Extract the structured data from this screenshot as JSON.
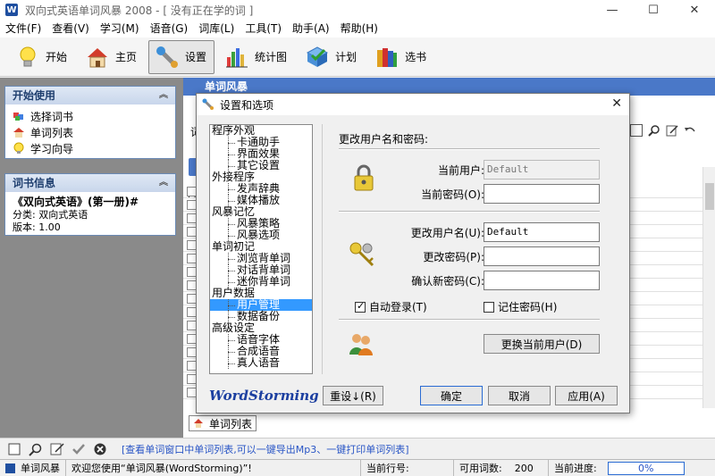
{
  "window": {
    "title": "双向式英语单词风暴 2008 - [ 没有正在学的词 ]",
    "icon_letter": "W",
    "controls": {
      "min": "—",
      "max": "☐",
      "close": "✕"
    }
  },
  "menu": [
    "文件(F)",
    "查看(V)",
    "学习(M)",
    "语音(G)",
    "词库(L)",
    "工具(T)",
    "助手(A)",
    "帮助(H)"
  ],
  "toolbar": [
    {
      "label": "开始",
      "icon": "lightbulb-icon"
    },
    {
      "label": "主页",
      "icon": "house-icon"
    },
    {
      "label": "设置",
      "icon": "wrench-icon",
      "active": true
    },
    {
      "label": "统计图",
      "icon": "bar-chart-icon"
    },
    {
      "label": "计划",
      "icon": "plan-icon"
    },
    {
      "label": "选书",
      "icon": "books-icon"
    }
  ],
  "left_panel": {
    "start_title": "开始使用",
    "start_items": [
      {
        "label": "选择词书",
        "icon": "cube-icon"
      },
      {
        "label": "单词列表",
        "icon": "house-icon"
      },
      {
        "label": "学习向导",
        "icon": "lightbulb-icon"
      }
    ],
    "book_title": "词书信息",
    "book_name": "《双向式英语》(第一册)#",
    "book_category": "分类: 双向式英语",
    "book_version": "版本: 1.00"
  },
  "main": {
    "header": "单词风暴",
    "row_prefix_1": "词",
    "row_prefix_2": "词",
    "tab_label": "单词列表"
  },
  "dialog": {
    "title": "设置和选项",
    "close": "✕",
    "tree": [
      {
        "label": "程序外观",
        "level": 0
      },
      {
        "label": "卡通助手",
        "level": 1
      },
      {
        "label": "界面效果",
        "level": 1
      },
      {
        "label": "其它设置",
        "level": 1
      },
      {
        "label": "外接程序",
        "level": 0
      },
      {
        "label": "发声辞典",
        "level": 1
      },
      {
        "label": "媒体播放",
        "level": 1
      },
      {
        "label": "风暴记忆",
        "level": 0
      },
      {
        "label": "风暴策略",
        "level": 1
      },
      {
        "label": "风暴选项",
        "level": 1
      },
      {
        "label": "单词初记",
        "level": 0
      },
      {
        "label": "浏览背单词",
        "level": 1
      },
      {
        "label": "对话背单词",
        "level": 1
      },
      {
        "label": "迷你背单词",
        "level": 1
      },
      {
        "label": "用户数据",
        "level": 0
      },
      {
        "label": "用户管理",
        "level": 1,
        "selected": true
      },
      {
        "label": "数据备份",
        "level": 1
      },
      {
        "label": "高级设定",
        "level": 0
      },
      {
        "label": "语音字体",
        "level": 1
      },
      {
        "label": "合成语音",
        "level": 1
      },
      {
        "label": "真人语音",
        "level": 1
      }
    ],
    "logo": "WordStorming",
    "section_title": "更改用户名和密码:",
    "current_user_label": "当前用户:",
    "current_user_value": "Default",
    "current_password_label": "当前密码(O):",
    "current_password_value": "",
    "change_user_label": "更改用户名(U):",
    "change_user_value": "Default",
    "change_password_label": "更改密码(P):",
    "change_password_value": "",
    "confirm_password_label": "确认新密码(C):",
    "confirm_password_value": "",
    "auto_login_label": "自动登录(T)",
    "auto_login_checked": true,
    "remember_password_label": "记住密码(H)",
    "remember_password_checked": false,
    "switch_user_label": "更换当前用户(D)",
    "reset_label": "重设↓(R)",
    "ok_label": "确定",
    "cancel_label": "取消",
    "apply_label": "应用(A)"
  },
  "bottom_hint": "[查看单词窗口中单词列表,可以一键导出Mp3、一键打印单词列表]",
  "status": {
    "app": "单词风暴",
    "welcome": "欢迎您使用“单词风暴(WordStorming)”!",
    "row_label": "当前行号:",
    "row_value": "",
    "available_label": "可用词数:",
    "available_value": "200",
    "progress_label": "当前进度:",
    "progress_value": "0%"
  }
}
